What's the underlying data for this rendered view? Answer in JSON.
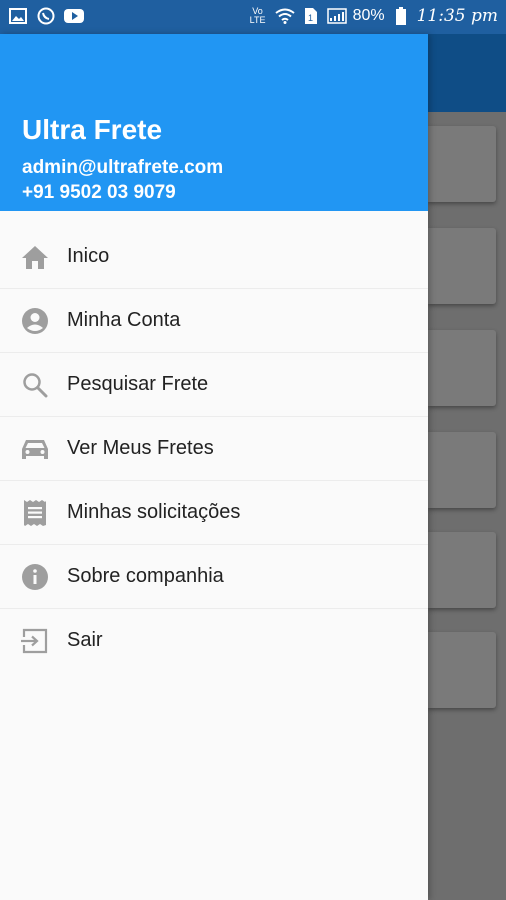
{
  "status_bar": {
    "time": "11:35 pm",
    "battery": "80%",
    "network_label": "Vo LTE"
  },
  "drawer": {
    "app_title": "Ultra Frete",
    "email": "admin@ultrafrete.com",
    "phone": "+91 9502 03 9079",
    "items": [
      {
        "label": "Inico",
        "icon": "home-icon"
      },
      {
        "label": "Minha Conta",
        "icon": "account-circle-icon"
      },
      {
        "label": "Pesquisar Frete",
        "icon": "search-icon"
      },
      {
        "label": "Ver Meus Fretes",
        "icon": "car-icon"
      },
      {
        "label": "Minhas solicitações",
        "icon": "receipt-icon"
      },
      {
        "label": "Sobre companhia",
        "icon": "info-icon"
      },
      {
        "label": "Sair",
        "icon": "exit-icon"
      }
    ]
  },
  "colors": {
    "header": "#2196f3",
    "status_bar": "#1f5fa0",
    "icon_gray": "#9e9e9e"
  }
}
